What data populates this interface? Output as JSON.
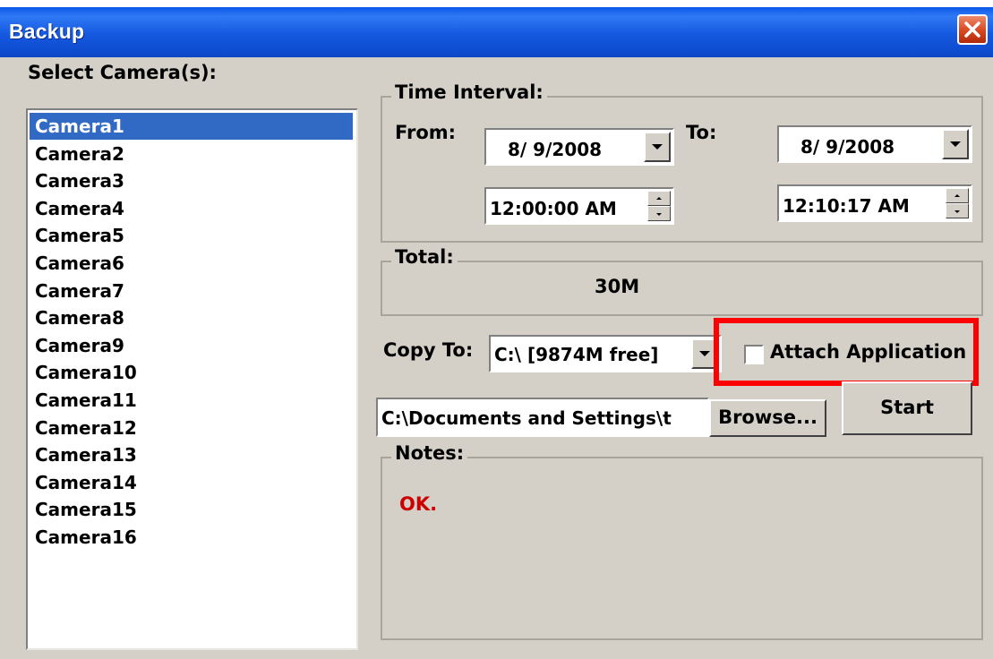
{
  "window": {
    "title": "Backup",
    "close_icon": "close-x-icon"
  },
  "cameras": {
    "label": "Select Camera(s):",
    "items": [
      "Camera1",
      "Camera2",
      "Camera3",
      "Camera4",
      "Camera5",
      "Camera6",
      "Camera7",
      "Camera8",
      "Camera9",
      "Camera10",
      "Camera11",
      "Camera12",
      "Camera13",
      "Camera14",
      "Camera15",
      "Camera16"
    ],
    "selected": "Camera1"
  },
  "time_interval": {
    "title": "Time Interval:",
    "from_label": "From:",
    "to_label": "To:",
    "from_date": "8/ 9/2008",
    "from_time": "12:00:00 AM",
    "to_date": "8/ 9/2008",
    "to_time": "12:10:17 AM"
  },
  "total": {
    "title": "Total:",
    "value": "30M"
  },
  "copy_to": {
    "label": "Copy To:",
    "selected": "C:\\ [9874M free]",
    "attach_label": "Attach Application",
    "attach_checked": false,
    "path": "C:\\Documents and Settings\\t",
    "browse_label": "Browse...",
    "start_label": "Start"
  },
  "notes": {
    "title": "Notes:",
    "text": "OK.",
    "text_color": "#cc0000"
  },
  "highlight_color": "#ff0000",
  "selection_color": "#316ac5"
}
